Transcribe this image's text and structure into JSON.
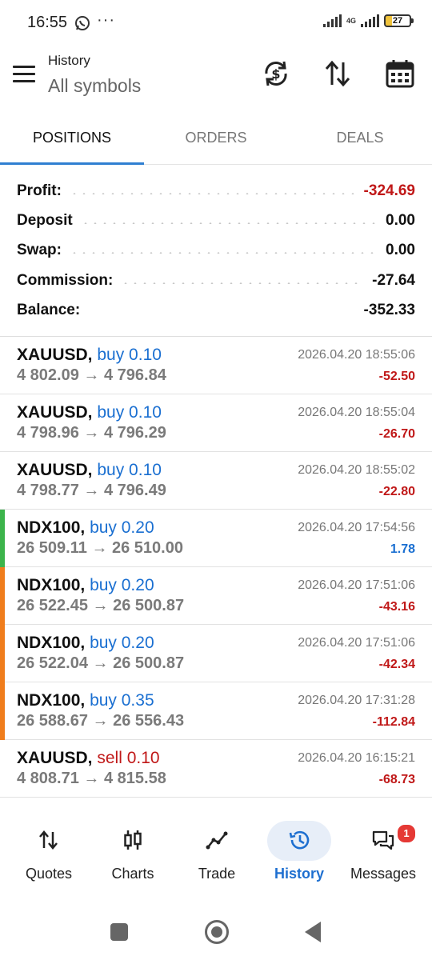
{
  "status_bar": {
    "time": "16:55",
    "more": "···",
    "network": "4G",
    "battery": "27",
    "icons": [
      "whatsapp-icon",
      "signal-icon",
      "battery-icon"
    ]
  },
  "app_bar": {
    "title": "History",
    "subtitle": "All symbols",
    "icons": [
      "menu-icon",
      "currency-sync-icon",
      "sort-icon",
      "calendar-icon"
    ]
  },
  "tabs": [
    {
      "label": "POSITIONS",
      "active": true
    },
    {
      "label": "ORDERS",
      "active": false
    },
    {
      "label": "DEALS",
      "active": false
    }
  ],
  "summary": [
    {
      "label": "Profit:",
      "value": "-324.69",
      "negative": true
    },
    {
      "label": "Deposit",
      "value": "0.00",
      "negative": false
    },
    {
      "label": "Swap:",
      "value": "0.00",
      "negative": false
    },
    {
      "label": "Commission:",
      "value": "-27.64",
      "negative": false
    },
    {
      "label": "Balance:",
      "value": "-352.33",
      "negative": false
    }
  ],
  "trades": [
    {
      "symbol": "XAUUSD,",
      "side": "buy 0.10",
      "side_type": "buy",
      "open": "4 802.09",
      "arrow": "→",
      "close": "4 796.84",
      "time": "2026.04.20 18:55:06",
      "profit": "-52.50",
      "profit_sign": "neg",
      "marker": "none"
    },
    {
      "symbol": "XAUUSD,",
      "side": "buy 0.10",
      "side_type": "buy",
      "open": "4 798.96",
      "arrow": "→",
      "close": "4 796.29",
      "time": "2026.04.20 18:55:04",
      "profit": "-26.70",
      "profit_sign": "neg",
      "marker": "none"
    },
    {
      "symbol": "XAUUSD,",
      "side": "buy 0.10",
      "side_type": "buy",
      "open": "4 798.77",
      "arrow": "→",
      "close": "4 796.49",
      "time": "2026.04.20 18:55:02",
      "profit": "-22.80",
      "profit_sign": "neg",
      "marker": "none"
    },
    {
      "symbol": "NDX100,",
      "side": "buy 0.20",
      "side_type": "buy",
      "open": "26 509.11",
      "arrow": "→",
      "close": "26 510.00",
      "time": "2026.04.20 17:54:56",
      "profit": "1.78",
      "profit_sign": "pos",
      "marker": "green"
    },
    {
      "symbol": "NDX100,",
      "side": "buy 0.20",
      "side_type": "buy",
      "open": "26 522.45",
      "arrow": "→",
      "close": "26 500.87",
      "time": "2026.04.20 17:51:06",
      "profit": "-43.16",
      "profit_sign": "neg",
      "marker": "orange"
    },
    {
      "symbol": "NDX100,",
      "side": "buy 0.20",
      "side_type": "buy",
      "open": "26 522.04",
      "arrow": "→",
      "close": "26 500.87",
      "time": "2026.04.20 17:51:06",
      "profit": "-42.34",
      "profit_sign": "neg",
      "marker": "orange"
    },
    {
      "symbol": "NDX100,",
      "side": "buy 0.35",
      "side_type": "buy",
      "open": "26 588.67",
      "arrow": "→",
      "close": "26 556.43",
      "time": "2026.04.20 17:31:28",
      "profit": "-112.84",
      "profit_sign": "neg",
      "marker": "orange"
    },
    {
      "symbol": "XAUUSD,",
      "side": "sell 0.10",
      "side_type": "sell",
      "open": "4 808.71",
      "arrow": "→",
      "close": "4 815.58",
      "time": "2026.04.20 16:15:21",
      "profit": "-68.73",
      "profit_sign": "neg",
      "marker": "none"
    }
  ],
  "bottom_nav": [
    {
      "label": "Quotes",
      "icon": "quotes-icon",
      "active": false
    },
    {
      "label": "Charts",
      "icon": "charts-icon",
      "active": false
    },
    {
      "label": "Trade",
      "icon": "trade-icon",
      "active": false
    },
    {
      "label": "History",
      "icon": "history-icon",
      "active": true
    },
    {
      "label": "Messages",
      "icon": "messages-icon",
      "active": false,
      "badge": "1"
    }
  ],
  "colors": {
    "accent": "#2f7fd1",
    "negative": "#c01818",
    "buy": "#1a6fd1",
    "marker_green": "#3cb44b",
    "marker_orange": "#f07d1c",
    "active_nav_bg": "#e7eef8"
  }
}
